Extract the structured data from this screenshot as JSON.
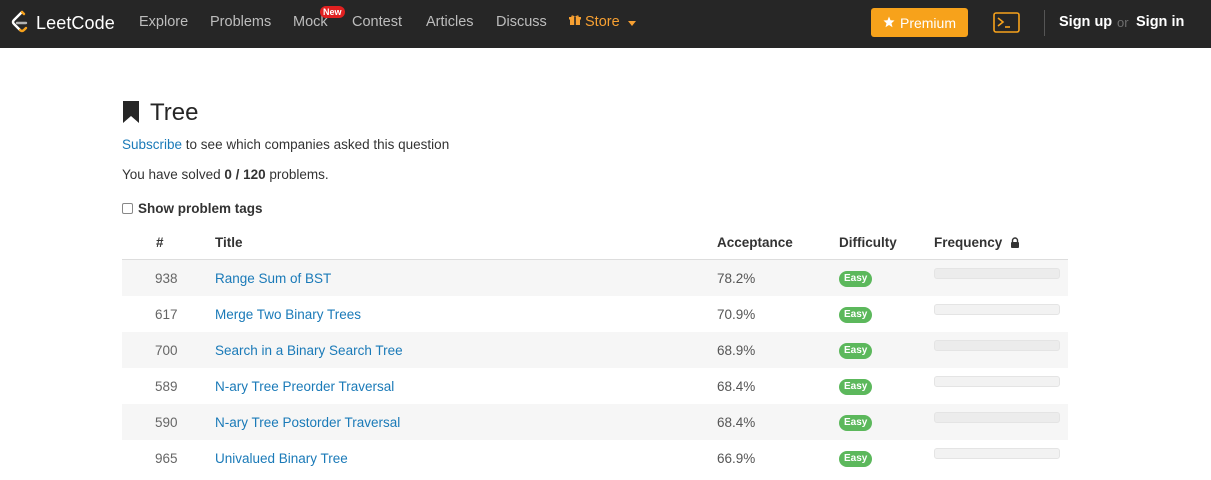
{
  "navbar": {
    "brand": "LeetCode",
    "links": {
      "explore": "Explore",
      "problems": "Problems",
      "mock": "Mock",
      "mock_badge": "New",
      "contest": "Contest",
      "articles": "Articles",
      "discuss": "Discuss",
      "store": "Store"
    },
    "premium": "Premium",
    "sign_up": "Sign up",
    "or": "or",
    "sign_in": "Sign in"
  },
  "page": {
    "title": "Tree",
    "subscribe_link": "Subscribe",
    "subscribe_rest": " to see which companies asked this question",
    "solved_prefix": "You have solved ",
    "solved_count": "0 / 120",
    "solved_suffix": " problems.",
    "show_tags": "Show problem tags"
  },
  "table": {
    "headers": {
      "num": "#",
      "title": "Title",
      "acceptance": "Acceptance",
      "difficulty": "Difficulty",
      "frequency": "Frequency"
    },
    "rows": [
      {
        "num": "938",
        "title": "Range Sum of BST",
        "acceptance": "78.2%",
        "difficulty": "Easy"
      },
      {
        "num": "617",
        "title": "Merge Two Binary Trees",
        "acceptance": "70.9%",
        "difficulty": "Easy"
      },
      {
        "num": "700",
        "title": "Search in a Binary Search Tree",
        "acceptance": "68.9%",
        "difficulty": "Easy"
      },
      {
        "num": "589",
        "title": "N-ary Tree Preorder Traversal",
        "acceptance": "68.4%",
        "difficulty": "Easy"
      },
      {
        "num": "590",
        "title": "N-ary Tree Postorder Traversal",
        "acceptance": "68.4%",
        "difficulty": "Easy"
      },
      {
        "num": "965",
        "title": "Univalued Binary Tree",
        "acceptance": "66.9%",
        "difficulty": "Easy"
      }
    ]
  },
  "icons": {
    "logo": "leetcode-logo-icon",
    "store": "gift-icon",
    "premium": "star-icon",
    "console": "terminal-icon",
    "title": "bookmark-icon",
    "frequency": "lock-icon"
  },
  "colors": {
    "navbar_bg": "#262626",
    "premium": "#f7a21b",
    "store": "#f7a032",
    "link": "#1a7ab8",
    "easy": "#5cb85c",
    "new_badge": "#e02020"
  }
}
